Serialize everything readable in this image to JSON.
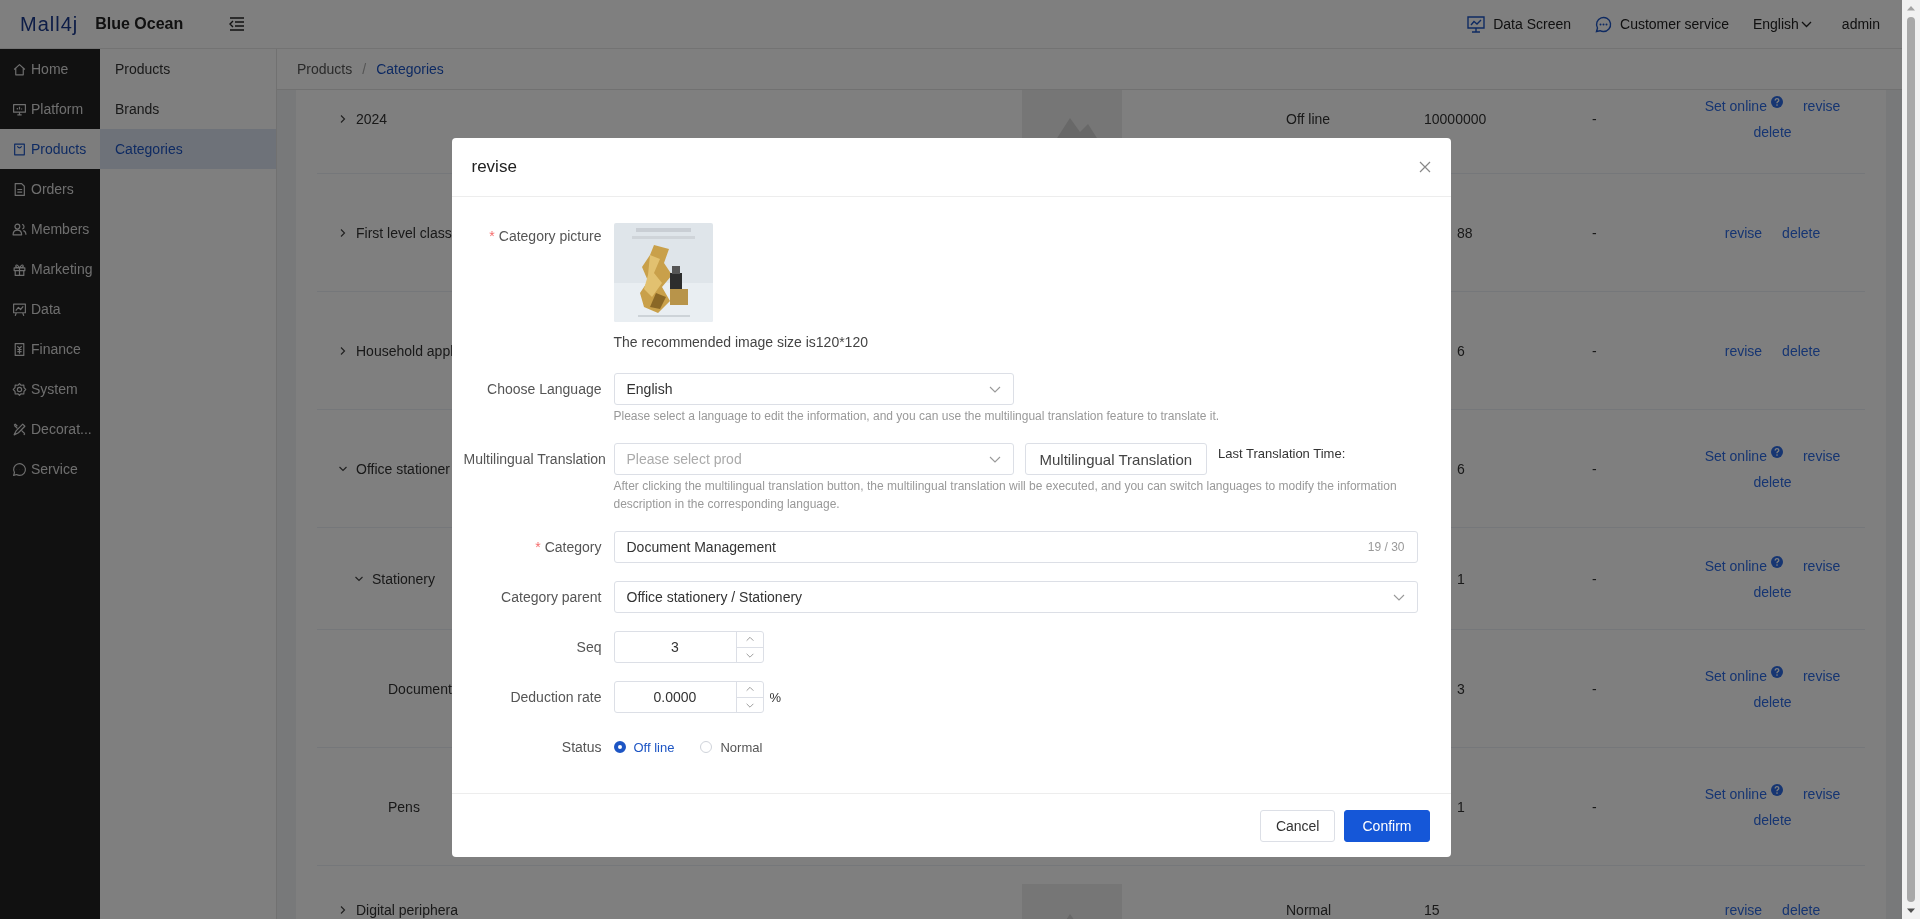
{
  "header": {
    "logo": "Mall4j",
    "brand": "Blue Ocean",
    "links": [
      "Data Screen",
      "Customer service"
    ],
    "language": "English",
    "user": "admin"
  },
  "nav": [
    {
      "label": "Home",
      "selected": false
    },
    {
      "label": "Platform",
      "selected": false
    },
    {
      "label": "Products",
      "selected": true
    },
    {
      "label": "Orders",
      "selected": false
    },
    {
      "label": "Members",
      "selected": false
    },
    {
      "label": "Marketing",
      "selected": false
    },
    {
      "label": "Data",
      "selected": false
    },
    {
      "label": "Finance",
      "selected": false
    },
    {
      "label": "System",
      "selected": false
    },
    {
      "label": "Decorat...",
      "selected": false
    },
    {
      "label": "Service",
      "selected": false
    }
  ],
  "subnav": [
    {
      "label": "Products",
      "selected": false
    },
    {
      "label": "Brands",
      "selected": false
    },
    {
      "label": "Categories",
      "selected": true
    }
  ],
  "breadcrumb": {
    "items": [
      "Products",
      "Categories"
    ],
    "separator": "/"
  },
  "table": {
    "rows": [
      {
        "name": "2024",
        "expanded": false,
        "column_3": "Off line",
        "column_4": "10000000",
        "column_5": "-",
        "actions": [
          {
            "label": "Set online",
            "help": true
          },
          {
            "label": "revise",
            "help": false
          },
          {
            "label": "delete",
            "help": false
          }
        ]
      },
      {
        "name": "First level class",
        "expanded": false,
        "column_4": "88",
        "column_5": "-",
        "actions": [
          {
            "label": "revise",
            "help": false
          },
          {
            "label": "delete",
            "help": false
          }
        ]
      },
      {
        "name": "Household appl",
        "expanded": false,
        "column_4": "6",
        "column_5": "-",
        "actions": [
          {
            "label": "revise",
            "help": false
          },
          {
            "label": "delete",
            "help": false
          }
        ]
      },
      {
        "name": "Office stationer",
        "expanded": true,
        "column_4": "6",
        "column_5": "-",
        "actions": [
          {
            "label": "Set online",
            "help": true
          },
          {
            "label": "revise",
            "help": false
          },
          {
            "label": "delete",
            "help": false
          }
        ],
        "children": [
          {
            "name": "Stationery",
            "expanded": true,
            "column_4": "1",
            "column_5": "-",
            "actions": [
              {
                "label": "Set online",
                "help": true
              },
              {
                "label": "revise",
                "help": false
              },
              {
                "label": "delete",
                "help": false
              }
            ],
            "children": [
              {
                "name": "Document",
                "column_4": "3",
                "column_5": "-",
                "actions": [
                  {
                    "label": "Set online",
                    "help": true
                  },
                  {
                    "label": "revise",
                    "help": false
                  },
                  {
                    "label": "delete",
                    "help": false
                  }
                ]
              },
              {
                "name": "Pens",
                "column_4": "1",
                "column_5": "-",
                "actions": [
                  {
                    "label": "Set online",
                    "help": true
                  },
                  {
                    "label": "revise",
                    "help": false
                  },
                  {
                    "label": "delete",
                    "help": false
                  }
                ]
              }
            ]
          }
        ]
      },
      {
        "name": "Digital periphera",
        "expanded": false,
        "column_3": "Normal",
        "column_4": "15",
        "actions": [
          {
            "label": "revise",
            "help": false
          },
          {
            "label": "delete",
            "help": false
          }
        ]
      }
    ]
  },
  "dialog": {
    "title": "revise",
    "fields": [
      {
        "kind": "picture",
        "label": "Category picture",
        "required_mark": "*",
        "hint": "The recommended image size is120*120"
      },
      {
        "kind": "select",
        "label": "Choose Language",
        "value": "English",
        "help": "Please select a language to edit the information, and you can use the multilingual translation feature to translate it."
      },
      {
        "kind": "translate",
        "label": "Multilingual Translation",
        "placeholder": "Please select prod",
        "button": "Multilingual Translation",
        "note": "Last Translation Time:",
        "help": "After clicking the multilingual translation button, the multilingual translation will be executed, and you can switch languages to modify the information description in the corresponding language."
      },
      {
        "kind": "text",
        "label": "Category",
        "required_mark": "*",
        "value": "Document Management",
        "count": "19 / 30"
      },
      {
        "kind": "select",
        "label": "Category parent",
        "value": "Office stationery / Stationery"
      },
      {
        "kind": "number",
        "label": "Seq",
        "value": "3"
      },
      {
        "kind": "number",
        "label": "Deduction rate",
        "value": "0.0000",
        "suffix": "%"
      },
      {
        "kind": "radio",
        "label": "Status",
        "options": [
          {
            "label": "Off line",
            "selected": true
          },
          {
            "label": "Normal",
            "selected": false
          }
        ]
      }
    ],
    "buttons": [
      {
        "label": "Cancel",
        "primary": false
      },
      {
        "label": "Confirm",
        "primary": true
      }
    ]
  }
}
